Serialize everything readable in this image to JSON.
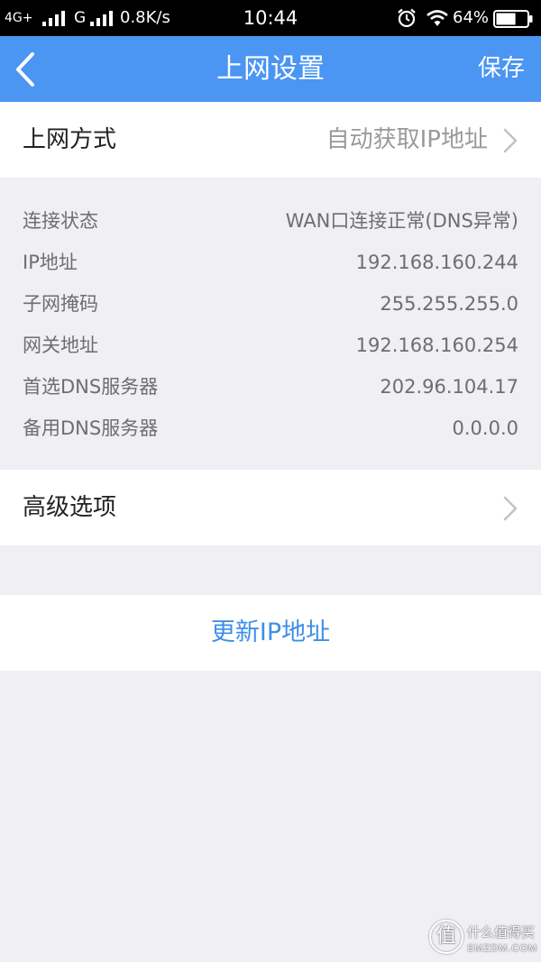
{
  "status_bar": {
    "network1": "4G+",
    "network2": "G",
    "speed": "0.8K/s",
    "time": "10:44",
    "battery_percent": "64%",
    "battery_level": 0.64
  },
  "nav": {
    "title": "上网设置",
    "save_label": "保存"
  },
  "connection_mode": {
    "label": "上网方式",
    "value": "自动获取IP地址"
  },
  "info_rows": [
    {
      "label": "连接状态",
      "value": "WAN口连接正常(DNS异常)"
    },
    {
      "label": "IP地址",
      "value": "192.168.160.244"
    },
    {
      "label": "子网掩码",
      "value": "255.255.255.0"
    },
    {
      "label": "网关地址",
      "value": "192.168.160.254"
    },
    {
      "label": "首选DNS服务器",
      "value": "202.96.104.17"
    },
    {
      "label": "备用DNS服务器",
      "value": "0.0.0.0"
    }
  ],
  "advanced": {
    "label": "高级选项"
  },
  "renew_button": {
    "label": "更新IP地址"
  },
  "watermark": {
    "glyph": "值",
    "name": "什么值得买",
    "site": "SMZDM.COM"
  },
  "icons": {
    "back": "chevron-left-icon",
    "disclosure": "chevron-right-icon",
    "signal": "signal-bars-icon",
    "alarm": "alarm-clock-icon",
    "wifi": "wifi-icon",
    "battery": "battery-icon"
  },
  "colors": {
    "status_bg": "#000000",
    "nav_bg": "#4b95f3",
    "page_bg": "#efeff4",
    "link": "#3d8ee8"
  }
}
